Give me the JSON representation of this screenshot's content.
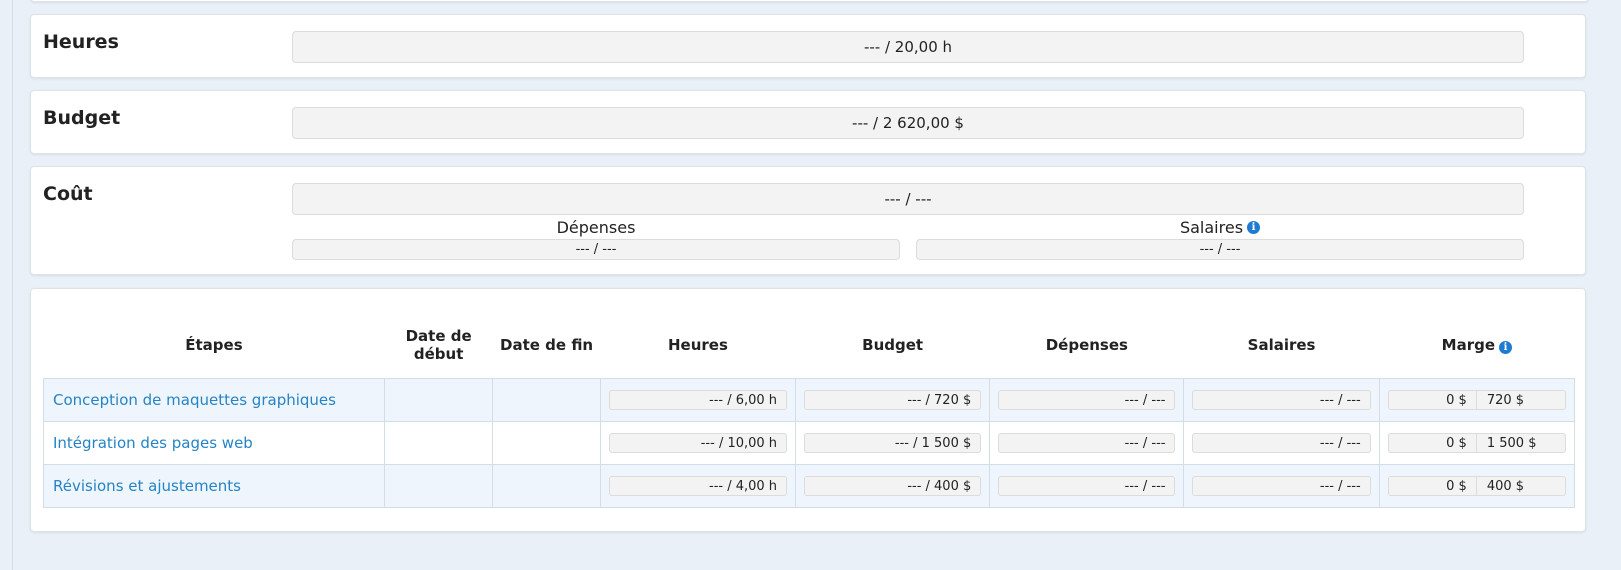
{
  "summary": {
    "hours": {
      "label": "Heures",
      "value": "--- / 20,00 h"
    },
    "budget": {
      "label": "Budget",
      "value": "--- / 2 620,00 $"
    },
    "cost": {
      "label": "Coût",
      "value": "--- / ---",
      "expenses_label": "Dépenses",
      "expenses_value": "--- / ---",
      "salaries_label": "Salaires",
      "salaries_value": "--- / ---"
    }
  },
  "steps_table": {
    "headers": {
      "steps": "Étapes",
      "start_date": "Date de début",
      "end_date": "Date de fin",
      "hours": "Heures",
      "budget": "Budget",
      "expenses": "Dépenses",
      "salaries": "Salaires",
      "margin": "Marge"
    },
    "rows": [
      {
        "name": "Conception de maquettes graphiques",
        "start_date": "",
        "end_date": "",
        "hours": "--- / 6,00 h",
        "budget": "--- / 720 $",
        "expenses": "--- / ---",
        "salaries": "--- / ---",
        "margin_actual": "0 $",
        "margin_planned": "720 $"
      },
      {
        "name": "Intégration des pages web",
        "start_date": "",
        "end_date": "",
        "hours": "--- / 10,00 h",
        "budget": "--- / 1 500 $",
        "expenses": "--- / ---",
        "salaries": "--- / ---",
        "margin_actual": "0 $",
        "margin_planned": "1 500 $"
      },
      {
        "name": "Révisions et ajustements",
        "start_date": "",
        "end_date": "",
        "hours": "--- / 4,00 h",
        "budget": "--- / 400 $",
        "expenses": "--- / ---",
        "salaries": "--- / ---",
        "margin_actual": "0 $",
        "margin_planned": "400 $"
      }
    ]
  },
  "icons": {
    "info": "info-icon"
  },
  "colors": {
    "link": "#2484c6",
    "info": "#1f7bd1",
    "row_highlight": "#eef5fc",
    "page_bg": "#eaf0f8"
  }
}
